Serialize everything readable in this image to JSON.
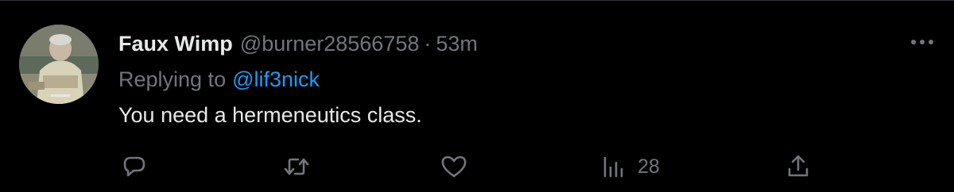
{
  "colors": {
    "background": "#000000",
    "primary_text": "#e7e9ea",
    "secondary_text": "#71767b",
    "link": "#1d9bf0",
    "divider": "#2f3336"
  },
  "tweet": {
    "author_name": "Faux Wimp",
    "handle": "@burner28566758",
    "separator": "·",
    "time": "53m",
    "replying_label": "Replying to",
    "replying_mention": "@lif3nick",
    "text": "You need a hermeneutics class.",
    "avatar_icon": "avatar-photo",
    "more_icon": "more-horizontal-icon",
    "actions": {
      "reply_icon": "reply-icon",
      "retweet_icon": "retweet-icon",
      "like_icon": "like-icon",
      "views_icon": "views-icon",
      "views_count": "28",
      "share_icon": "share-icon"
    }
  }
}
